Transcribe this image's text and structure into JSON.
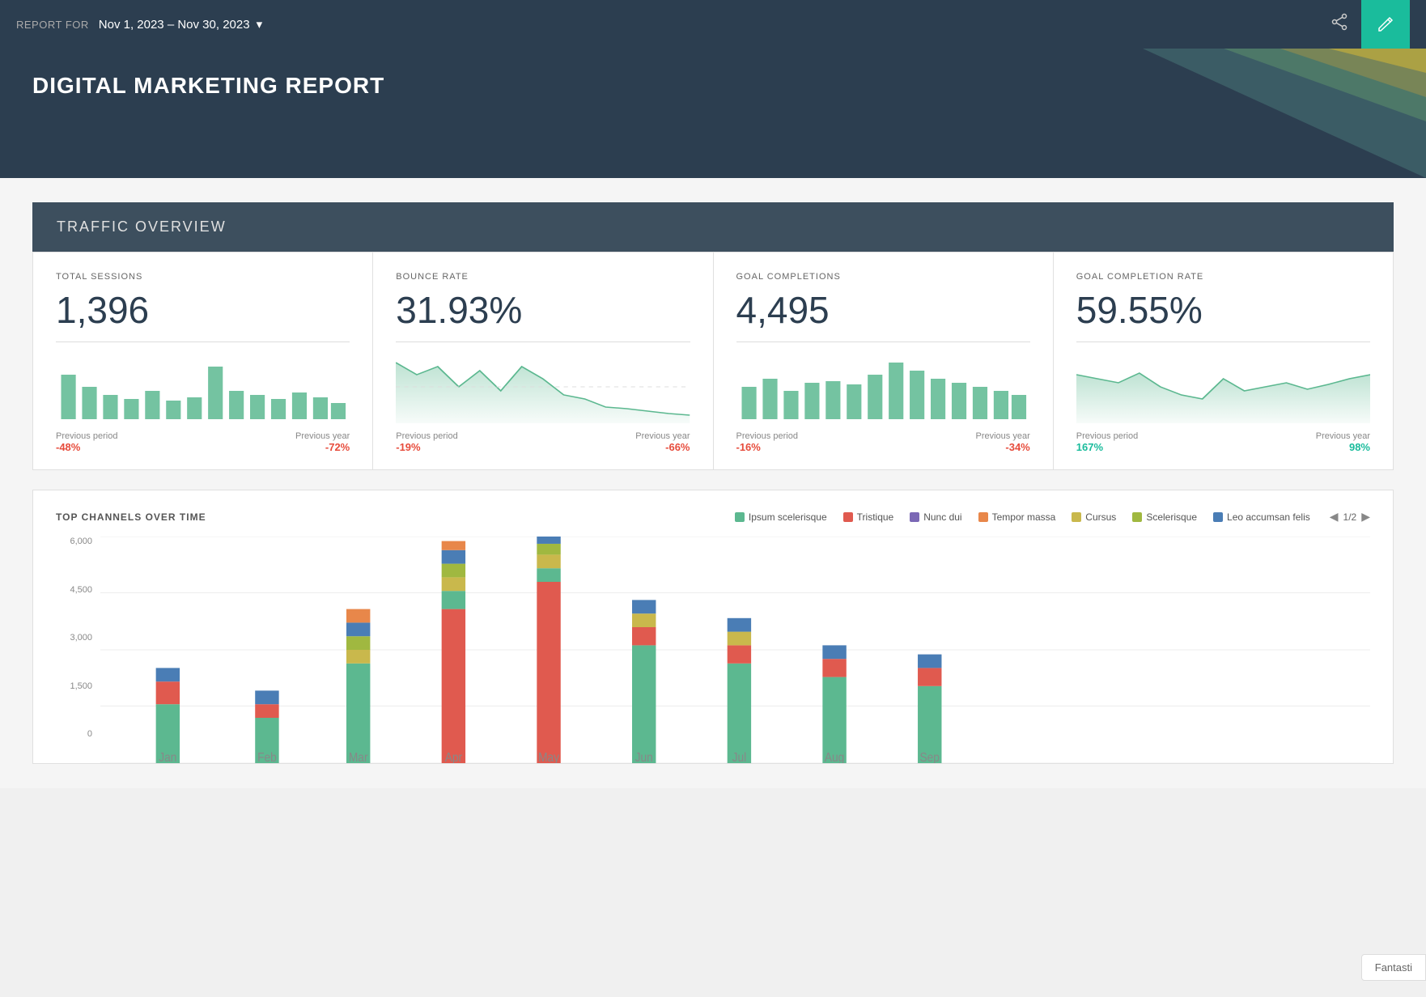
{
  "topBar": {
    "reportForLabel": "REPORT FOR",
    "dateRange": "Nov 1, 2023 – Nov 30, 2023",
    "shareIcon": "⎘",
    "editIcon": "✎"
  },
  "hero": {
    "title": "DIGITAL MARKETING REPORT"
  },
  "trafficOverview": {
    "sectionTitle": "TRAFFIC OVERVIEW",
    "cards": [
      {
        "label": "TOTAL SESSIONS",
        "value": "1,396",
        "previousPeriodLabel": "Previous period",
        "previousPeriodChange": "-48%",
        "previousYearLabel": "Previous year",
        "previousYearChange": "-72%",
        "changeType": "negative"
      },
      {
        "label": "BOUNCE RATE",
        "value": "31.93%",
        "previousPeriodLabel": "Previous period",
        "previousPeriodChange": "-19%",
        "previousYearLabel": "Previous year",
        "previousYearChange": "-66%",
        "changeType": "negative"
      },
      {
        "label": "GOAL COMPLETIONS",
        "value": "4,495",
        "previousPeriodLabel": "Previous period",
        "previousPeriodChange": "-16%",
        "previousYearLabel": "Previous year",
        "previousYearChange": "-34%",
        "changeType": "negative"
      },
      {
        "label": "GOAL COMPLETION RATE",
        "value": "59.55%",
        "previousPeriodLabel": "Previous period",
        "previousPeriodChange": "167%",
        "previousYearLabel": "Previous year",
        "previousYearChange": "98%",
        "changeType": "positive"
      }
    ]
  },
  "topChannels": {
    "title": "TOP CHANNELS OVER TIME",
    "pagination": "1/2",
    "legend": [
      {
        "label": "Ipsum scelerisque",
        "color": "#5cb890"
      },
      {
        "label": "Tristique",
        "color": "#e05a4f"
      },
      {
        "label": "Nunc dui",
        "color": "#7b68b5"
      },
      {
        "label": "Tempor massa",
        "color": "#e8874a"
      },
      {
        "label": "Cursus",
        "color": "#c9b84c"
      },
      {
        "label": "Scelerisque",
        "color": "#a0b840"
      },
      {
        "label": "Leo accumsan felis",
        "color": "#4a7db5"
      }
    ],
    "yAxisLabels": [
      "6,000",
      "4,500",
      "3,000",
      "1,500"
    ]
  },
  "fantasticBadge": "Fantasti"
}
